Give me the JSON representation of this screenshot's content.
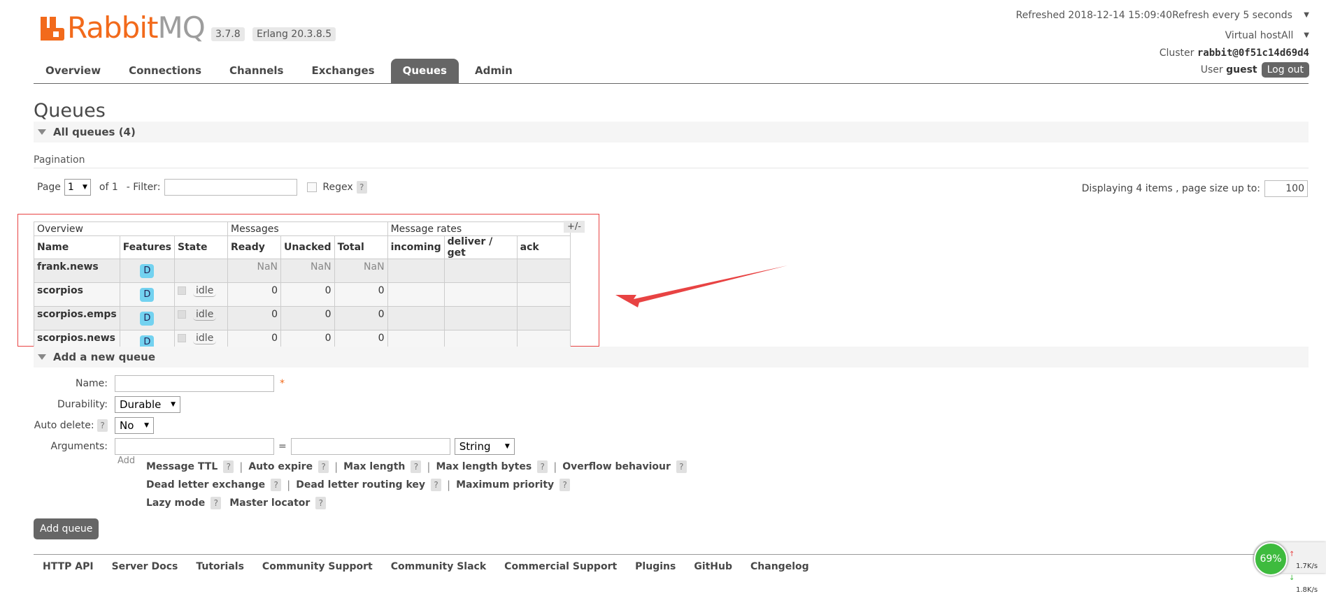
{
  "app": {
    "logo_part1": "Rabbit",
    "logo_part2": "MQ",
    "version": "3.7.8",
    "erlang": "Erlang 20.3.8.5"
  },
  "header": {
    "refreshed": "Refreshed 2018-12-14 15:09:40",
    "refresh_select": "Refresh every 5 seconds",
    "vhost_label": "Virtual host",
    "vhost_value": "All",
    "cluster_label": "Cluster",
    "cluster_value": "rabbit@0f51c14d69d4",
    "user_label": "User",
    "user_value": "guest",
    "logout": "Log out"
  },
  "nav": {
    "tabs": [
      "Overview",
      "Connections",
      "Channels",
      "Exchanges",
      "Queues",
      "Admin"
    ],
    "active": "Queues"
  },
  "page": {
    "title": "Queues",
    "all_queues": "All queues (4)",
    "pagination": "Pagination"
  },
  "pagination": {
    "page_label": "Page",
    "page_value": "1",
    "of_label": "of 1",
    "filter_label": "- Filter:",
    "regex_label": "Regex",
    "help": "?",
    "displaying": "Displaying 4 items , page size up to:",
    "page_size": "100"
  },
  "table": {
    "group_headers": [
      "Overview",
      "Messages",
      "Message rates"
    ],
    "plus_minus": "+/-",
    "columns": [
      "Name",
      "Features",
      "State",
      "Ready",
      "Unacked",
      "Total",
      "incoming",
      "deliver / get",
      "ack"
    ],
    "rows": [
      {
        "name": "frank.news",
        "feature": "D",
        "state": "",
        "ready": "NaN",
        "unacked": "NaN",
        "total": "NaN"
      },
      {
        "name": "scorpios",
        "feature": "D",
        "state": "idle",
        "ready": "0",
        "unacked": "0",
        "total": "0"
      },
      {
        "name": "scorpios.emps",
        "feature": "D",
        "state": "idle",
        "ready": "0",
        "unacked": "0",
        "total": "0"
      },
      {
        "name": "scorpios.news",
        "feature": "D",
        "state": "idle",
        "ready": "0",
        "unacked": "0",
        "total": "0"
      }
    ]
  },
  "add_queue": {
    "section_title": "Add a new queue",
    "name_label": "Name:",
    "required_mark": "*",
    "durability_label": "Durability:",
    "durability_value": "Durable",
    "auto_delete_label": "Auto delete:",
    "auto_delete_value": "No",
    "arguments_label": "Arguments:",
    "equals": "=",
    "arg_type": "String",
    "add_label": "Add",
    "arg_links": [
      [
        "Message TTL",
        "Auto expire",
        "Max length",
        "Max length bytes",
        "Overflow behaviour"
      ],
      [
        "Dead letter exchange",
        "Dead letter routing key",
        "Maximum priority"
      ],
      [
        "Lazy mode",
        "Master locator"
      ]
    ],
    "submit": "Add queue"
  },
  "footer": {
    "links": [
      "HTTP API",
      "Server Docs",
      "Tutorials",
      "Community Support",
      "Community Slack",
      "Commercial Support",
      "Plugins",
      "GitHub",
      "Changelog"
    ]
  },
  "net_widget": {
    "percent": "69%",
    "up": "1.7K/s",
    "down": "1.8K/s",
    "up_arrow": "↑",
    "down_arrow": "↓"
  },
  "colors": {
    "brand_orange": "#f26a1b",
    "annotation_red": "#e84343",
    "tab_active": "#666666",
    "badge_blue": "#73d2f0"
  }
}
